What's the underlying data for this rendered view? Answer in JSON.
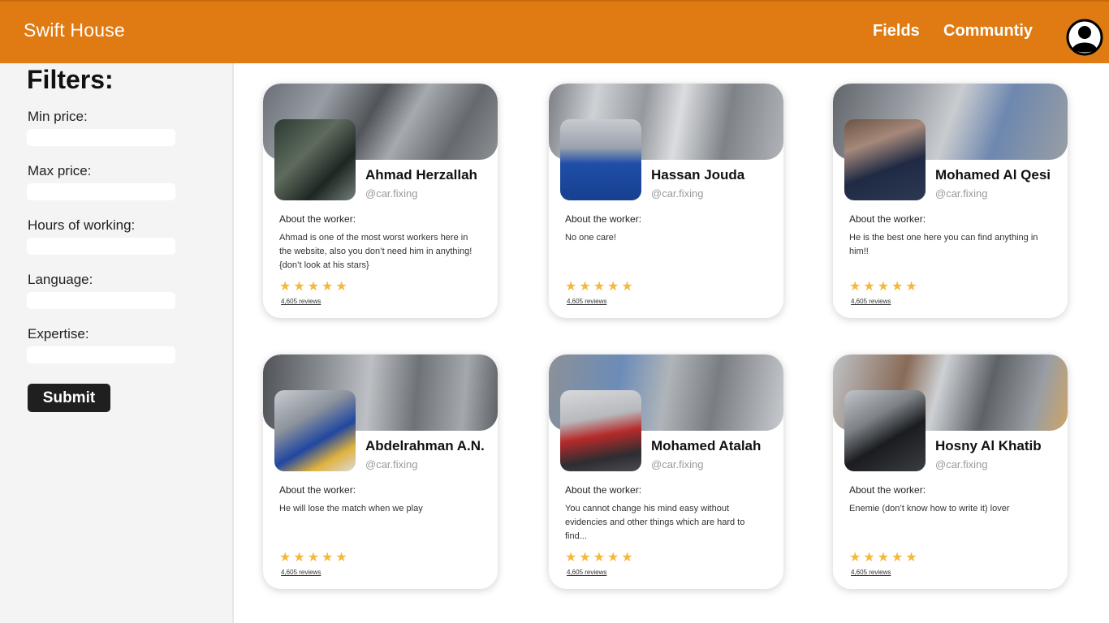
{
  "header": {
    "brand": "Swift House",
    "nav": [
      "Fields",
      "Communtiy"
    ]
  },
  "filters": {
    "title": "Filters:",
    "fields": [
      {
        "label": "Min price:",
        "value": ""
      },
      {
        "label": "Max price:",
        "value": ""
      },
      {
        "label": "Hours of working:",
        "value": ""
      },
      {
        "label": "Language:",
        "value": ""
      },
      {
        "label": "Expertise:",
        "value": ""
      }
    ],
    "submit_label": "Submit"
  },
  "workers": [
    {
      "name": "Ahmad Herzallah",
      "handle": "@car.fixing",
      "about_label": "About the worker:",
      "description": "Ahmad is one of the most worst workers here in the website, also you don’t need him in anything! {don’t look at his stars}",
      "stars": "★★★★★",
      "reviews": "4,605 reviews"
    },
    {
      "name": "Hassan Jouda",
      "handle": "@car.fixing",
      "about_label": "About the worker:",
      "description": "No one care!",
      "stars": "★★★★★",
      "reviews": "4,605 reviews"
    },
    {
      "name": "Mohamed Al Qesi",
      "handle": "@car.fixing",
      "about_label": "About the worker:",
      "description": "He is the best one here you can find anything in him!!",
      "stars": "★★★★★",
      "reviews": "4,605 reviews"
    },
    {
      "name": "Abdelrahman A.N.",
      "handle": "@car.fixing",
      "about_label": "About the worker:",
      "description": "He will lose the match when we play",
      "stars": "★★★★★",
      "reviews": "4,605 reviews"
    },
    {
      "name": "Mohamed Atalah",
      "handle": "@car.fixing",
      "about_label": "About the worker:",
      "description": "You cannot change his mind easy without evidencies and other things which are hard to find...",
      "stars": "★★★★★",
      "reviews": "4,605 reviews"
    },
    {
      "name": "Hosny Al Khatib",
      "handle": "@car.fixing",
      "about_label": "About the worker:",
      "description": "Enemie (don’t know how to write it) lover",
      "stars": "★★★★★",
      "reviews": "4,605 reviews"
    }
  ],
  "colors": {
    "header": "#e07b14",
    "star": "#f3b93a",
    "sidebar": "#f4f4f4"
  }
}
